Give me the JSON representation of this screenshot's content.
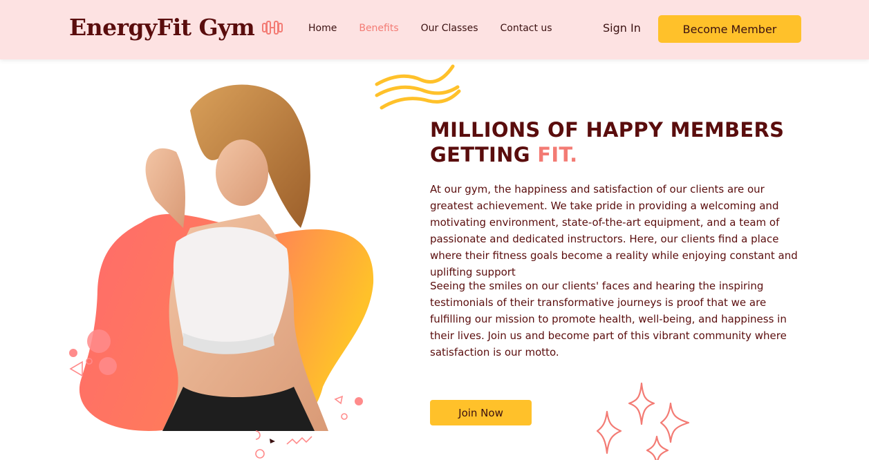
{
  "nav": {
    "brand": "EnergyFit Gym",
    "brand_icon": "dumbbell-icon",
    "items": [
      {
        "label": "Home",
        "active": false
      },
      {
        "label": "Benefits",
        "active": true
      },
      {
        "label": "Our Classes",
        "active": false
      },
      {
        "label": "Contact us",
        "active": false
      }
    ],
    "signin_label": "Sign In",
    "cta_label": "Become Member"
  },
  "hero": {
    "headline_main": "MILLIONS OF HAPPY MEMBERS GETTING ",
    "headline_accent": "FIT.",
    "paragraph_1": "At our gym, the happiness and satisfaction of our clients are our greatest achievement. We take pride in providing a welcoming and motivating environment, state-of-the-art equipment, and a team of passionate and dedicated instructors. Here, our clients find a place where their fitness goals become a reality while enjoying constant and uplifting support",
    "paragraph_2": "Seeing the smiles on our clients' faces and hearing the inspiring testimonials of their transformative journeys is proof that we are fulfilling our mission to promote health, well-being, and happiness in their lives. Join us and become part of this vibrant community where satisfaction is our motto.",
    "join_label": "Join Now"
  },
  "colors": {
    "nav_bg": "#fde2e2",
    "accent_coral": "#f37b74",
    "accent_yellow": "#ffc12a",
    "text_dark": "#5a0d0d"
  }
}
